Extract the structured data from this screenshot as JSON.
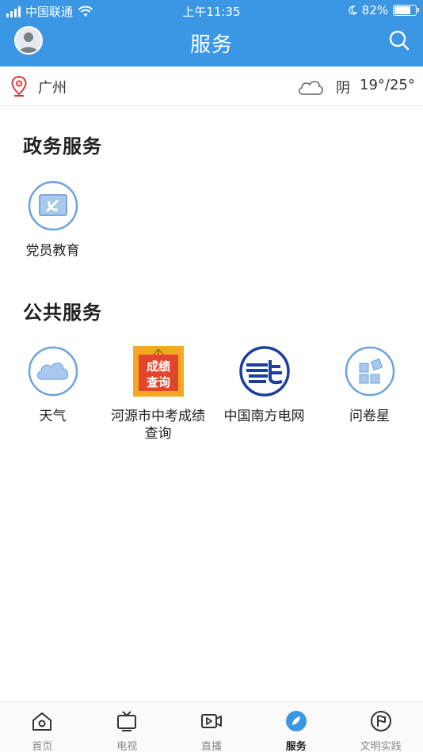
{
  "status_bar": {
    "carrier": "中国联通",
    "time": "上午11:35",
    "battery": "82%",
    "battery_level": 0.82
  },
  "header": {
    "title": "服务"
  },
  "location": {
    "city": "广州",
    "condition": "阴",
    "temperature": "19°/25°"
  },
  "sections": [
    {
      "title": "政务服务",
      "items": [
        {
          "label": "党员教育",
          "icon": "party-flag-icon"
        }
      ]
    },
    {
      "title": "公共服务",
      "items": [
        {
          "label": "天气",
          "icon": "cloud-icon"
        },
        {
          "label": "河源市中考成绩查询",
          "icon": "score-query-icon",
          "icon_text_1": "成绩",
          "icon_text_2": "查询"
        },
        {
          "label": "中国南方电网",
          "icon": "power-grid-icon"
        },
        {
          "label": "问卷星",
          "icon": "survey-icon"
        }
      ]
    }
  ],
  "tabs": [
    {
      "label": "首页",
      "icon": "home-icon",
      "active": false
    },
    {
      "label": "电视",
      "icon": "tv-icon",
      "active": false
    },
    {
      "label": "直播",
      "icon": "live-video-icon",
      "active": false
    },
    {
      "label": "服务",
      "icon": "compass-icon",
      "active": true
    },
    {
      "label": "文明实践",
      "icon": "flag-circle-icon",
      "active": false
    }
  ],
  "colors": {
    "primary": "#3b97e3",
    "icon_ring": "#6aa3e0",
    "score_orange": "#f5a623",
    "score_red": "#e2452b",
    "grid_blue": "#1a3f9c"
  }
}
